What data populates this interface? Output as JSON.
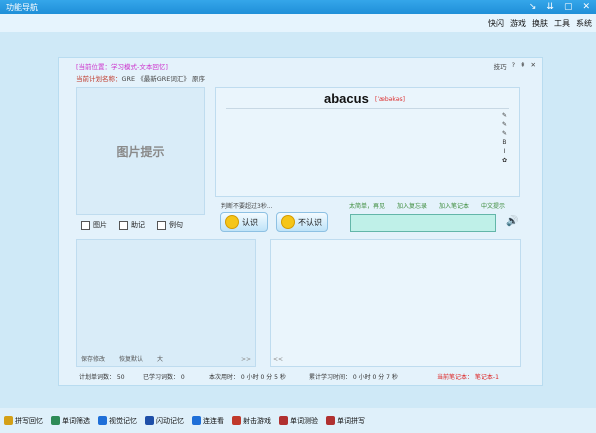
{
  "window": {
    "title": "功能导航",
    "controls": [
      "↘",
      "⇊",
      "▢",
      "✕"
    ]
  },
  "menubar": [
    "快闪",
    "游戏",
    "换肤",
    "工具",
    "系统"
  ],
  "panel": {
    "location": "[当前位置：学习模式-文本回忆]",
    "plan_label": "当前计划名称：",
    "plan_value": "GRE  《最新GRE词汇》 原序",
    "tools": [
      "技巧",
      "?",
      "⇞",
      "✕"
    ],
    "picture_hint": "图片提示",
    "word": "abacus",
    "phonetic": "[ˈæbəkəs]",
    "editor_tools": [
      "✎",
      "✎",
      "✎",
      "B",
      "I",
      "✿"
    ],
    "hint": "判断不要超过3秒...",
    "links": [
      "太简单，再见",
      "加入复忘录",
      "加入笔记本",
      "中文提示"
    ],
    "checks": [
      "图片",
      "助记",
      "例句"
    ],
    "know_label": "认识",
    "unknow_label": "不认识",
    "left_footer": [
      "保存修改",
      "恢复默认",
      "大"
    ],
    "left_scroll": ">>",
    "right_scroll": "<<",
    "stats": {
      "plan_words": "计划单词数：  50",
      "learned": "已学习词数：  0",
      "this_time": "本次用时：     0 小时 0 分 5 秒",
      "total_time": "累计学习时间：    0 小时 0 分 7 秒",
      "notebook": "当前笔记本：  笔记本-1"
    }
  },
  "bottom_items": [
    {
      "label": "拼写回忆",
      "color": "#d4a017"
    },
    {
      "label": "单词筛选",
      "color": "#2e8b57"
    },
    {
      "label": "视觉记忆",
      "color": "#1e6fd8"
    },
    {
      "label": "闪动记忆",
      "color": "#1e4fa8"
    },
    {
      "label": "连连看",
      "color": "#1e6fd8"
    },
    {
      "label": "射击游戏",
      "color": "#c0392b"
    },
    {
      "label": "单词测验",
      "color": "#b03030"
    },
    {
      "label": "单词拼写",
      "color": "#b03030"
    }
  ]
}
